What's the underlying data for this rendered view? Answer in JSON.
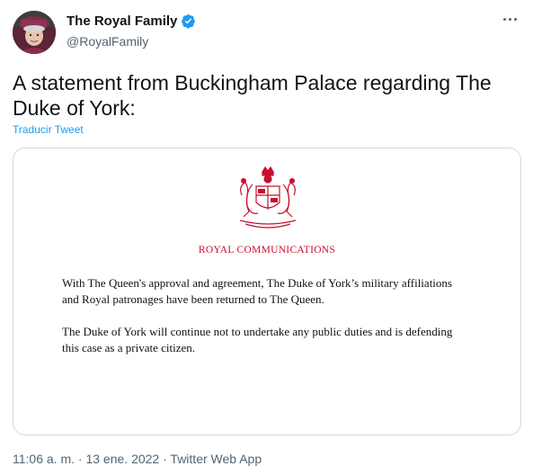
{
  "author": {
    "name": "The Royal Family",
    "handle": "@RoyalFamily"
  },
  "tweet": {
    "text": "A statement from Buckingham Palace regarding The Duke of York:",
    "translate_label": "Traducir Tweet"
  },
  "document": {
    "heading": "ROYAL COMMUNICATIONS",
    "paragraphs": [
      "With The Queen's approval and agreement, The Duke of York’s military affiliations and Royal patronages have been returned to The Queen.",
      "The Duke of York will continue not to undertake any public duties and is defending this case as a private citizen."
    ]
  },
  "meta": {
    "time": "11:06 a. m.",
    "separator": " · ",
    "date": "13 ene. 2022",
    "app": "Twitter Web App"
  },
  "colors": {
    "accent": "#1d9bf0",
    "crest": "#c8102e",
    "text": "#0f1419",
    "muted": "#536471"
  }
}
